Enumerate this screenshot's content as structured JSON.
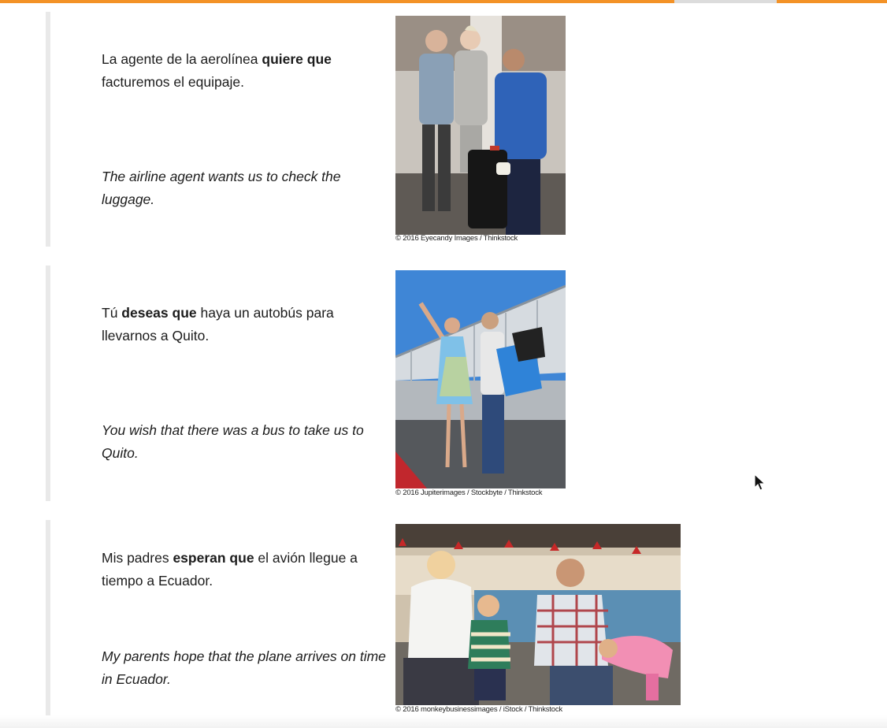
{
  "examples": [
    {
      "es_pre": "La agente de la aerolínea ",
      "es_bold": "quiere que",
      "es_post": " facturemos el equipaje.",
      "en": "The airline agent wants us to check the luggage.",
      "photo_icon": "airline-agent-photo",
      "credit": "© 2016 Eyecandy Images / Thinkstock"
    },
    {
      "es_pre": "Tú ",
      "es_bold": "deseas que",
      "es_post": " haya un autobús para llevarnos a Quito.",
      "en": "You wish that there was a bus to take us to Quito.",
      "photo_icon": "airport-couple-photo",
      "credit": "© 2016 Jupiterimages / Stockbyte / Thinkstock"
    },
    {
      "es_pre": "Mis padres ",
      "es_bold": "esperan que",
      "es_post": " el avión llegue a tiempo a Ecuador.",
      "en": "My parents hope that the plane arrives on time in Ecuador.",
      "photo_icon": "family-waiting-photo",
      "credit": "© 2016 monkeybusinessimages / iStock / Thinkstock"
    }
  ],
  "colors": {
    "accent": "#f39227",
    "rule": "#e9e9e9"
  },
  "cursor_icon": "mouse-pointer-icon"
}
